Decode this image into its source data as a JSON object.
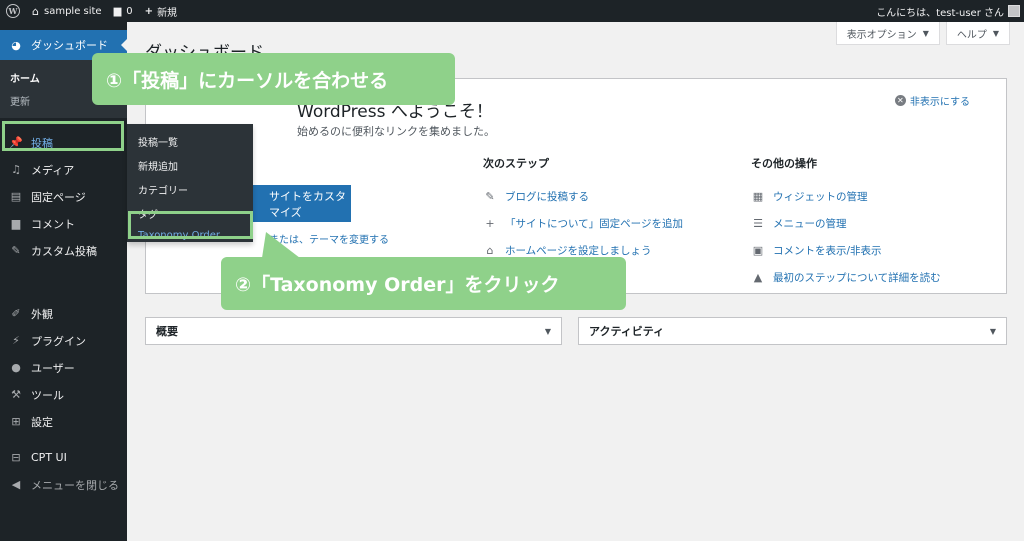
{
  "adminbar": {
    "site_name": "sample site",
    "comments_count": "0",
    "new_label": "新規",
    "greeting": "こんにちは、test-user さん"
  },
  "sidebar": {
    "dashboard": "ダッシュボード",
    "home": "ホーム",
    "updates": "更新",
    "posts": "投稿",
    "media": "メディア",
    "pages": "固定ページ",
    "comments": "コメント",
    "custom_posts": "カスタム投稿",
    "appearance": "外観",
    "plugins": "プラグイン",
    "users": "ユーザー",
    "tools": "ツール",
    "settings": "設定",
    "cpt_ui": "CPT UI",
    "collapse": "メニューを閉じる"
  },
  "flyout": {
    "items": [
      "投稿一覧",
      "新規追加",
      "カテゴリー",
      "タグ",
      "Taxonomy Order"
    ]
  },
  "main": {
    "screen_options": "表示オプション",
    "help": "ヘルプ",
    "page_title": "ダッシュボード",
    "welcome_title": "WordPress へようこそ！",
    "welcome_about": "始めるのに便利なリンクを集めました。",
    "dismiss": "非表示にする",
    "customize_button": "サイトをカスタマイズ",
    "faded_link": "または、テーマを変更する",
    "next_steps": {
      "heading": "次のステップ",
      "links": [
        "ブログに投稿する",
        "「サイトについて」固定ページを追加",
        "ホームページを設定しましょう"
      ]
    },
    "more_actions": {
      "heading": "その他の操作",
      "links": [
        "ウィジェットの管理",
        "メニューの管理",
        "コメントを表示/非表示",
        "最初のステップについて詳細を読む"
      ]
    },
    "postboxes": [
      "概要",
      "アクティビティ"
    ]
  },
  "callouts": {
    "step1": "①「投稿」にカーソルを合わせる",
    "step2": "②「Taxonomy Order」をクリック"
  },
  "colors": {
    "admin_dark": "#1d2327",
    "accent_blue": "#2271b1",
    "callout_green": "#8fd18a"
  }
}
